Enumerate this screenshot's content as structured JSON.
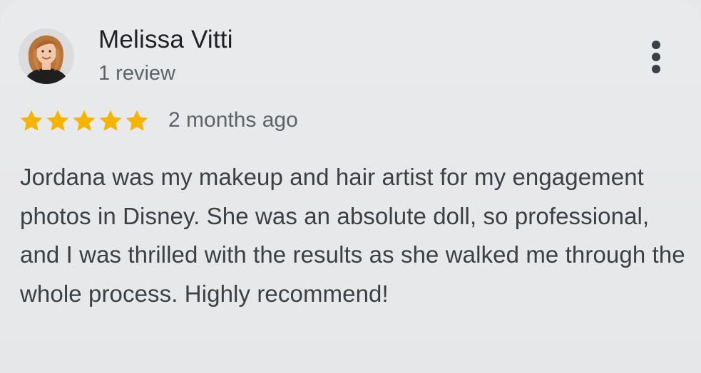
{
  "reviewer": {
    "name": "Melissa Vitti",
    "review_count": "1 review",
    "avatar_icon": "person-photo"
  },
  "rating": {
    "stars": 5,
    "max_stars": 5,
    "star_color": "#f6b400",
    "star_icon": "star-icon"
  },
  "time_ago": "2 months ago",
  "menu": {
    "icon": "more-vert-icon"
  },
  "review_text": "Jordana was my makeup and hair artist for my engagement photos in Disney. She was an absolute doll, so professional, and I was thrilled with the results as she walked me through the whole process. Highly recommend!"
}
